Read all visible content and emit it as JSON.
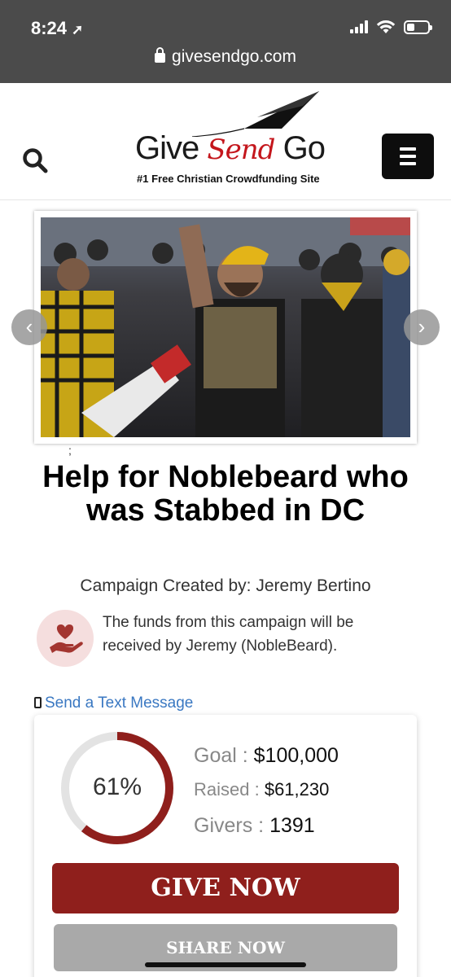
{
  "status_bar": {
    "time": "8:24",
    "location_glyph": "➚"
  },
  "browser": {
    "url": "givesendgo.com"
  },
  "header": {
    "logo_give": "Give",
    "logo_send": "Send",
    "logo_go": "Go",
    "tagline": "#1 Free Christian Crowdfunding Site"
  },
  "hero": {
    "prev_glyph": "‹",
    "next_glyph": "›",
    "stray_mark": ";"
  },
  "campaign": {
    "title": "Help for Noblebeard who was Stabbed in DC",
    "creator": "Campaign Created by: Jeremy Bertino",
    "recipient_text": "The funds from this campaign will be received by Jeremy (NobleBeard).",
    "send_text": "Send a Text Message"
  },
  "stats": {
    "percent_label": "61%",
    "percent_value": 61,
    "goal_label": "Goal : ",
    "goal_value": "$100,000",
    "raised_label": "Raised : ",
    "raised_value": "$61,230",
    "givers_label": "Givers : ",
    "givers_value": "1391"
  },
  "buttons": {
    "give": "GIVE NOW",
    "share": "SHARE NOW"
  },
  "colors": {
    "brand_red": "#8f1f1c",
    "link_blue": "#3a78c2",
    "progress_track": "#e3e3e3"
  }
}
